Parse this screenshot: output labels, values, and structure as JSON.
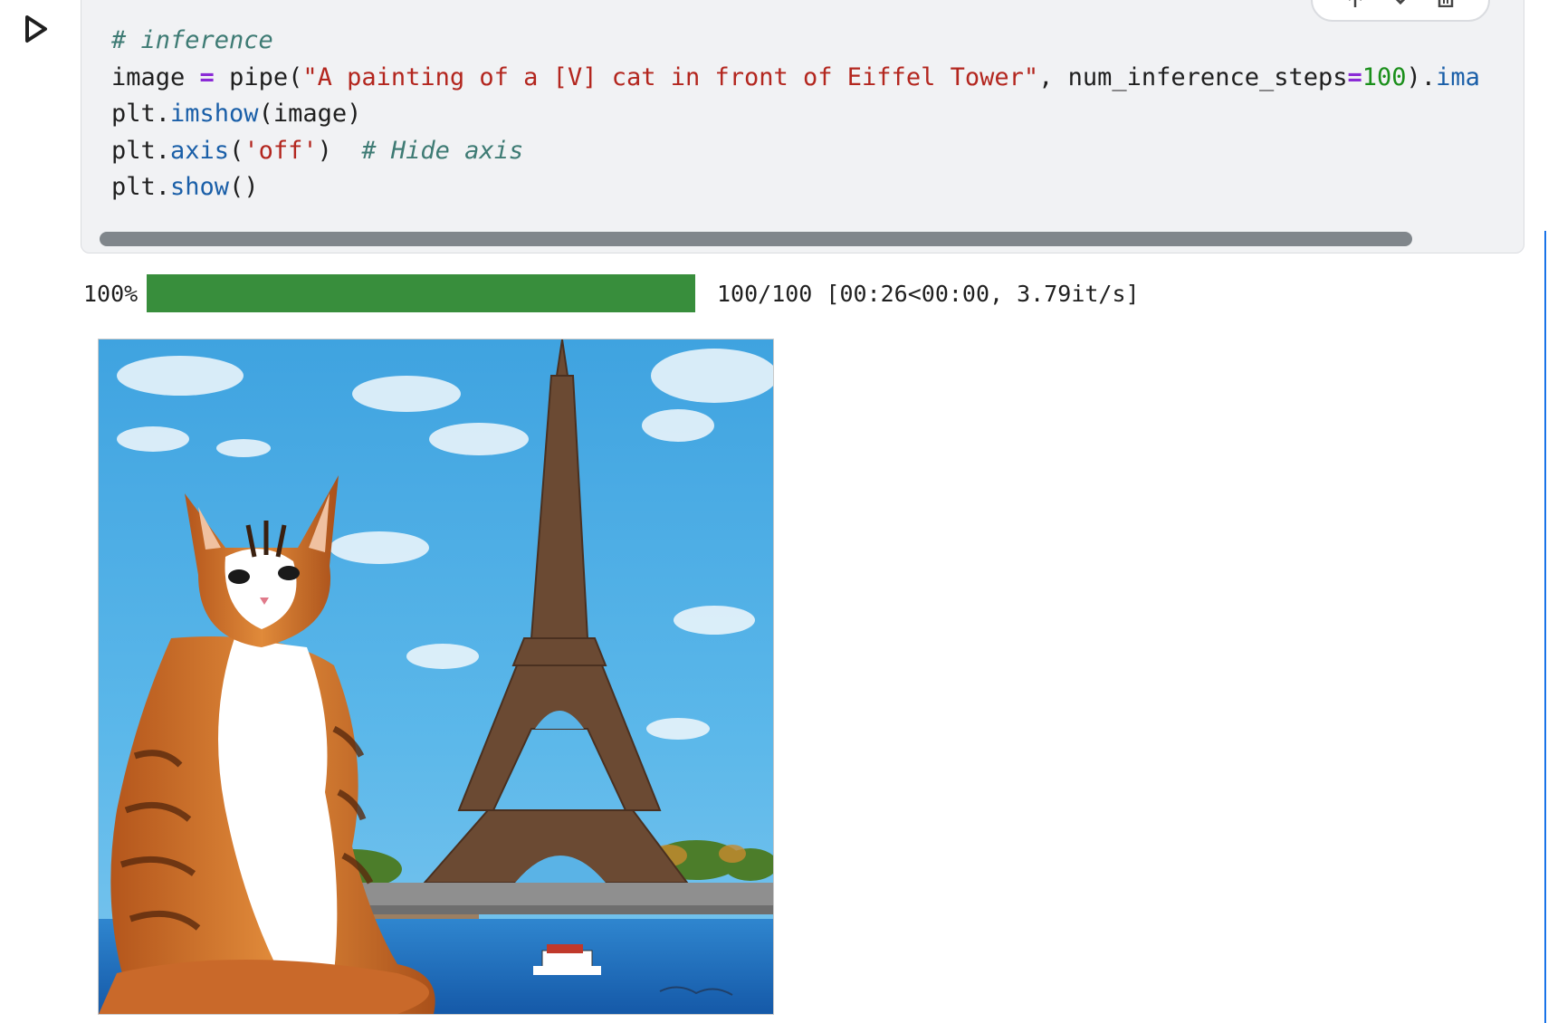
{
  "cell": {
    "run_button_icon": "play-icon",
    "toolbar_icons": [
      "arrow-up-icon",
      "arrow-down-icon",
      "delete-icon"
    ],
    "code": {
      "line1_comment": "# inference",
      "line2_var": "image",
      "line2_eq": " = ",
      "line2_fn": "pipe(",
      "line2_str": "\"A painting of a [V] cat in front of Eiffel Tower\"",
      "line2_sep": ", num_inference_steps",
      "line2_eq2": "=",
      "line2_num": "100",
      "line2_close": ").",
      "line2_attr": "ima",
      "line3_obj": "plt.",
      "line3_fn": "imshow",
      "line3_args": "(image)",
      "line4_obj": "plt.",
      "line4_fn": "axis",
      "line4_open": "(",
      "line4_str": "'off'",
      "line4_close": ")  ",
      "line4_comment": "# Hide axis",
      "line5_obj": "plt.",
      "line5_fn": "show",
      "line5_args": "()"
    }
  },
  "output": {
    "progress_label": "100%",
    "progress_fraction": 1.0,
    "progress_stats": "100/100 [00:26<00:00,  3.79it/s]",
    "progress_color": "#388e3c",
    "image_description_icon": "generated-image"
  }
}
